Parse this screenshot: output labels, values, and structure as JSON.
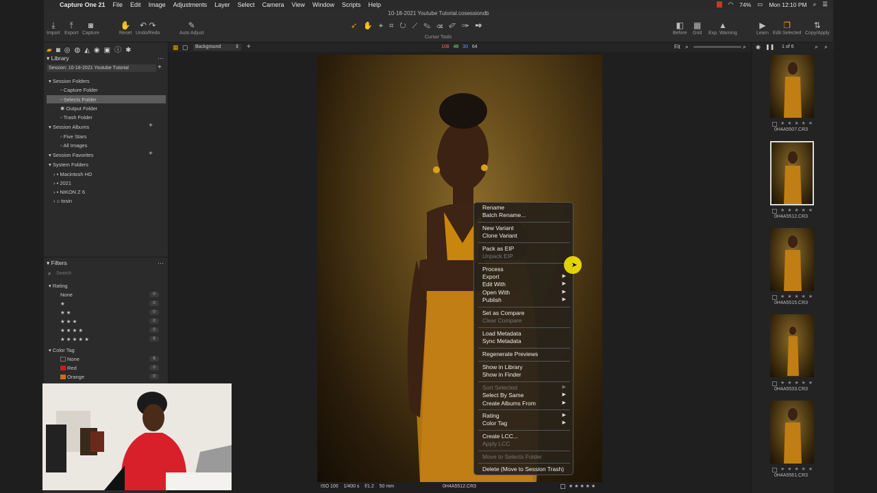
{
  "menubar": {
    "app": "Capture One 21",
    "items": [
      "File",
      "Edit",
      "Image",
      "Adjustments",
      "Layer",
      "Select",
      "Camera",
      "View",
      "Window",
      "Scripts",
      "Help"
    ],
    "battery": "74%",
    "clock": "Mon 12:10 PM"
  },
  "window": {
    "title": "10-18-2021 Youtube Tutorial.cosessiondb"
  },
  "toolbar": {
    "import": "Import",
    "export": "Export",
    "capture": "Capture",
    "reset": "Reset",
    "undo_redo": "Undo/Redo",
    "auto_adjust": "Auto Adjust",
    "cursor_tools": "Cursor Tools",
    "before": "Before",
    "grid": "Grid",
    "exp_warning": "Exp. Warning",
    "learn": "Learn",
    "edit_selected": "Edit Selected",
    "copy_apply": "Copy/Apply"
  },
  "viewerbar": {
    "layer": "Background",
    "rgb": {
      "r": "108",
      "g": "48",
      "b": "30",
      "l": "64"
    },
    "fit": "Fit",
    "count": "1 of 6"
  },
  "library": {
    "title": "Library",
    "session": "Session: 10-18-2021 Youtube Tutorial",
    "session_folders": "Session Folders",
    "folders": [
      "Capture Folder",
      "Selects Folder",
      "Output Folder",
      "Trash Folder"
    ],
    "session_albums": "Session Albums",
    "albums": [
      "Five Stars",
      "All Images"
    ],
    "session_favorites": "Session Favorites",
    "system_folders": "System Folders",
    "system": [
      "Macintosh HD",
      "2021",
      "NIKON Z 6",
      "tosin"
    ]
  },
  "filters": {
    "title": "Filters",
    "search_placeholder": "Search",
    "rating_label": "Rating",
    "ratings": [
      {
        "label": "None",
        "count": "0"
      },
      {
        "label": "★",
        "count": "0"
      },
      {
        "label": "★ ★",
        "count": "0"
      },
      {
        "label": "★ ★ ★",
        "count": "0"
      },
      {
        "label": "★ ★ ★ ★",
        "count": "0"
      },
      {
        "label": "★ ★ ★ ★ ★",
        "count": "6"
      }
    ],
    "color_tag_label": "Color Tag",
    "colors": [
      {
        "label": "None",
        "count": "6",
        "color": "#2b2b2b"
      },
      {
        "label": "Red",
        "count": "0",
        "color": "#c0221c"
      },
      {
        "label": "Orange",
        "count": "0",
        "color": "#d26a1a"
      }
    ]
  },
  "context_menu": {
    "rename": "Rename",
    "batch_rename": "Batch Rename...",
    "new_variant": "New Variant",
    "clone_variant": "Clone Variant",
    "pack_eip": "Pack as EIP",
    "unpack_eip": "Unpack EIP",
    "process": "Process",
    "export": "Export",
    "edit_with": "Edit With",
    "open_with": "Open With",
    "publish": "Publish",
    "set_compare": "Set as Compare",
    "clear_compare": "Clear Compare",
    "load_metadata": "Load Metadata",
    "sync_metadata": "Sync Metadata",
    "regenerate": "Regenerate Previews",
    "show_library": "Show in Library",
    "show_finder": "Show in Finder",
    "sort_selected": "Sort Selected",
    "select_by_same": "Select By Same",
    "create_albums": "Create Albums From",
    "rating": "Rating",
    "color_tag": "Color Tag",
    "create_lcc": "Create LCC...",
    "apply_lcc": "Apply LCC",
    "move_selects": "Move to Selects Folder",
    "delete": "Delete (Move to Session Trash)"
  },
  "image_info": {
    "iso": "ISO 100",
    "shutter": "1/400 s",
    "aperture": "f/1.2",
    "focal": "50 mm",
    "filename": "0H4A5512.CR3",
    "stars": "★ ★ ★ ★ ★"
  },
  "thumbnails": [
    {
      "name": "0H4A5507.CR3",
      "stars": "★ ★ ★ ★ ★"
    },
    {
      "name": "0H4A5512.CR3",
      "stars": "★ ★ ★ ★ ★"
    },
    {
      "name": "0H4A5515.CR3",
      "stars": "★ ★ ★ ★ ★"
    },
    {
      "name": "0H4A5533.CR3",
      "stars": "★ ★ ★ ★ ★"
    },
    {
      "name": "0H4A5561.CR3",
      "stars": "★ ★ ★ ★ ★"
    }
  ]
}
